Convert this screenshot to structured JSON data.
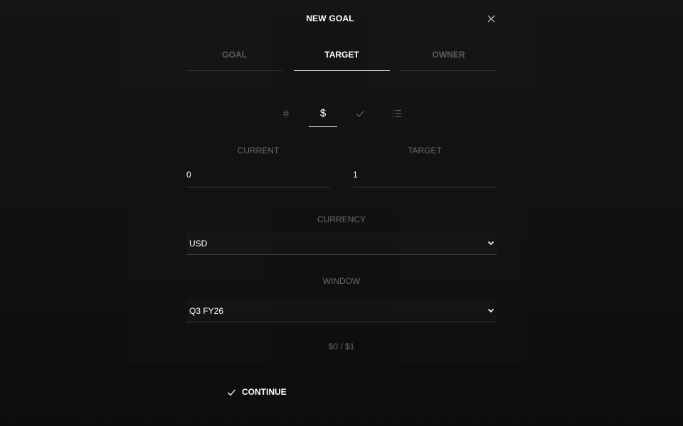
{
  "modal": {
    "title": "NEW GOAL"
  },
  "tabs": [
    {
      "label": "GOAL"
    },
    {
      "label": "TARGET"
    },
    {
      "label": "OWNER"
    }
  ],
  "active_tab": "TARGET",
  "metric_types": [
    {
      "icon": "hash-icon",
      "glyph": "#"
    },
    {
      "icon": "dollar-icon",
      "glyph": "$"
    },
    {
      "icon": "check-icon",
      "glyph": "✓"
    },
    {
      "icon": "list-icon",
      "glyph": ""
    }
  ],
  "active_metric_type": "dollar-icon",
  "fields": {
    "current": {
      "label": "CURRENT",
      "value": "0"
    },
    "target": {
      "label": "TARGET",
      "value": "1"
    },
    "currency": {
      "label": "CURRENCY",
      "value": "USD"
    },
    "window": {
      "label": "WINDOW",
      "value": "Q3 FY26"
    }
  },
  "summary": "$0 / $1",
  "continue_label": "CONTINUE",
  "colors": {
    "background": "#141414",
    "text_primary": "#ffffff",
    "text_muted": "#5e5e5e",
    "divider": "#3a3a3a"
  }
}
